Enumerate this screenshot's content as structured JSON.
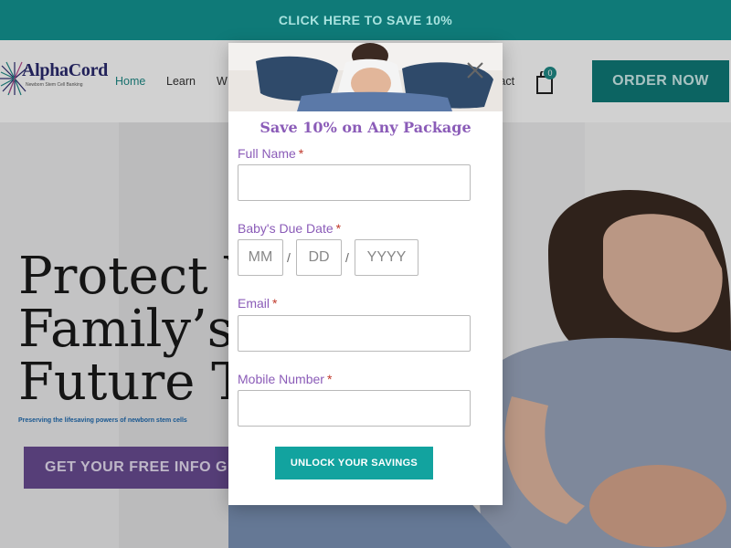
{
  "promo": {
    "text": "CLICK HERE TO SAVE 10%"
  },
  "header": {
    "logo": {
      "name": "AlphaCord",
      "tagline": "Newborn Stem Cell Banking"
    },
    "nav": {
      "home": "Home",
      "learn": "Learn",
      "partial": "W",
      "contact": "ntact"
    },
    "cart_count": "0",
    "order_button": "ORDER NOW"
  },
  "hero": {
    "title_lines": [
      "Protect Y",
      "Family’s",
      "Future To"
    ],
    "subtitle": "Preserving the lifesaving powers of newborn stem cells",
    "guide_button": "GET YOUR FREE INFO GUIDE"
  },
  "modal": {
    "heading": "Save 10% on Any Package",
    "full_name": {
      "label": "Full Name",
      "required_mark": "*",
      "value": ""
    },
    "due_date": {
      "label": "Baby's Due Date",
      "required_mark": "*",
      "mm_placeholder": "MM",
      "dd_placeholder": "DD",
      "yyyy_placeholder": "YYYY",
      "separator": "/"
    },
    "email": {
      "label": "Email",
      "required_mark": "*",
      "value": ""
    },
    "mobile": {
      "label": "Mobile Number",
      "required_mark": "*",
      "value": ""
    },
    "submit_button": "UNLOCK YOUR SAVINGS"
  },
  "colors": {
    "brand_teal": "#0f7a78",
    "accent_purple": "#8b5cb8",
    "button_teal": "#12a39f",
    "guide_purple": "#6a4c93"
  }
}
